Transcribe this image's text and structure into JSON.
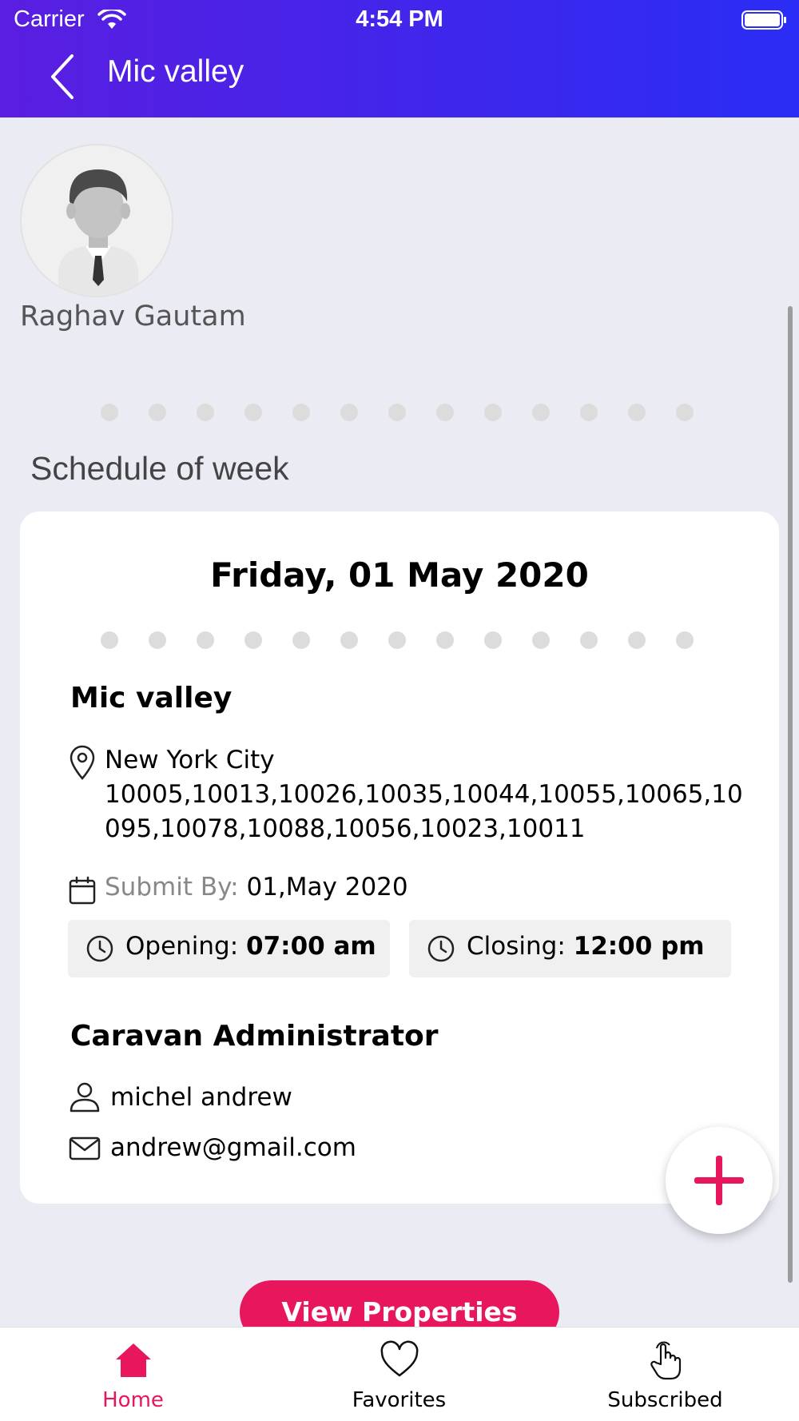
{
  "status_bar": {
    "carrier": "Carrier",
    "time": "4:54 PM"
  },
  "nav": {
    "title": "Mic valley",
    "back_icon": "chevron-left-icon"
  },
  "profile": {
    "name": "Raghav Gautam",
    "avatar_icon": "person-avatar-icon"
  },
  "schedule": {
    "section_title": "Schedule of week",
    "date": "Friday, 01 May 2020",
    "place": "Mic valley",
    "city": "New York City",
    "zip_codes": "10005,10013,10026,10035,10044,10055,10065,10095,10078,10088,10056,10023,10011",
    "submit_label": "Submit By:",
    "submit_value": "01,May 2020",
    "opening_label": "Opening:",
    "opening_value": "07:00 am",
    "closing_label": "Closing:",
    "closing_value": "12:00 pm"
  },
  "admin": {
    "title": "Caravan Administrator",
    "name": "michel andrew",
    "email": "andrew@gmail.com"
  },
  "cta": {
    "label": "View Properties"
  },
  "tabs": [
    {
      "label": "Home",
      "icon": "home-icon",
      "active": true
    },
    {
      "label": "Favorites",
      "icon": "heart-icon",
      "active": false
    },
    {
      "label": "Subscribed",
      "icon": "hand-pointer-icon",
      "active": false
    }
  ],
  "colors": {
    "accent": "#e8175d",
    "header_start": "#5a1ee0",
    "header_end": "#2a2df5",
    "background": "#ebebf4"
  }
}
